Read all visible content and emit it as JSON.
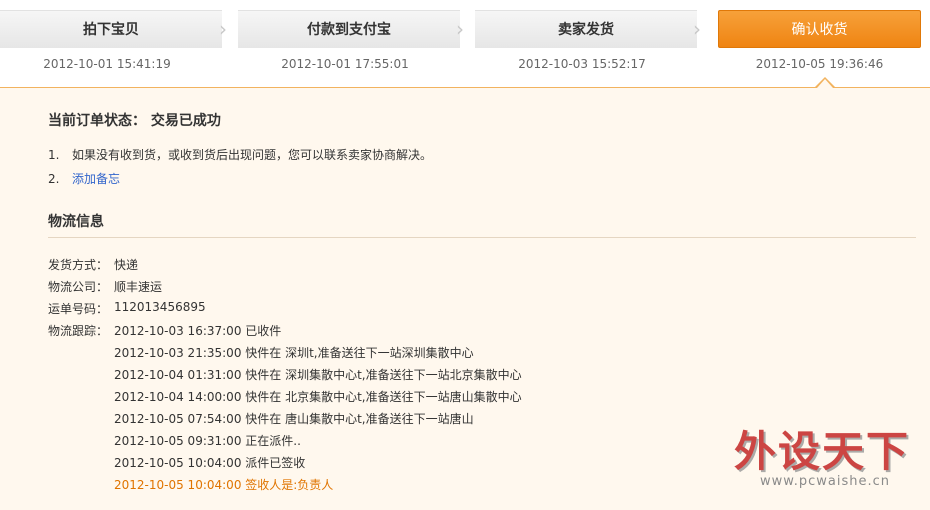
{
  "steps": [
    {
      "label": "拍下宝贝",
      "time": "2012-10-01 15:41:19",
      "active": false
    },
    {
      "label": "付款到支付宝",
      "time": "2012-10-01 17:55:01",
      "active": false
    },
    {
      "label": "卖家发货",
      "time": "2012-10-03 15:52:17",
      "active": false
    },
    {
      "label": "确认收货",
      "time": "2012-10-05 19:36:46",
      "active": true
    }
  ],
  "order": {
    "status_label": "当前订单状态：",
    "status_value": "交易已成功",
    "tips": [
      {
        "num": "1.",
        "text": "如果没有收到货，或收到货后出现问题，您可以联系卖家协商解决。"
      },
      {
        "num": "2.",
        "text": "添加备忘"
      }
    ]
  },
  "logistics": {
    "title": "物流信息",
    "fields": [
      {
        "label": "发货方式：",
        "value": "快递"
      },
      {
        "label": "物流公司：",
        "value": "顺丰速运"
      },
      {
        "label": "运单号码：",
        "value": "112013456895"
      }
    ],
    "tracking_label": "物流跟踪：",
    "tracking": [
      "2012-10-03 16:37:00 已收件",
      "2012-10-03 21:35:00 快件在 深圳t,准备送往下一站深圳集散中心",
      "2012-10-04 01:31:00 快件在 深圳集散中心t,准备送往下一站北京集散中心",
      "2012-10-04 14:00:00 快件在 北京集散中心t,准备送往下一站唐山集散中心",
      "2012-10-05 07:54:00 快件在 唐山集散中心t,准备送往下一站唐山",
      "2012-10-05 09:31:00 正在派件..",
      "2012-10-05 10:04:00 派件已签收",
      "2012-10-05 10:04:00 签收人是:负责人"
    ]
  },
  "watermark": {
    "main": "外设天下",
    "url": "www.pcwaishe.cn"
  },
  "colors": {
    "accent": "#ef8412",
    "link": "#3366cc",
    "latest": "#e07400",
    "panel_bg": "#fff8ee"
  }
}
